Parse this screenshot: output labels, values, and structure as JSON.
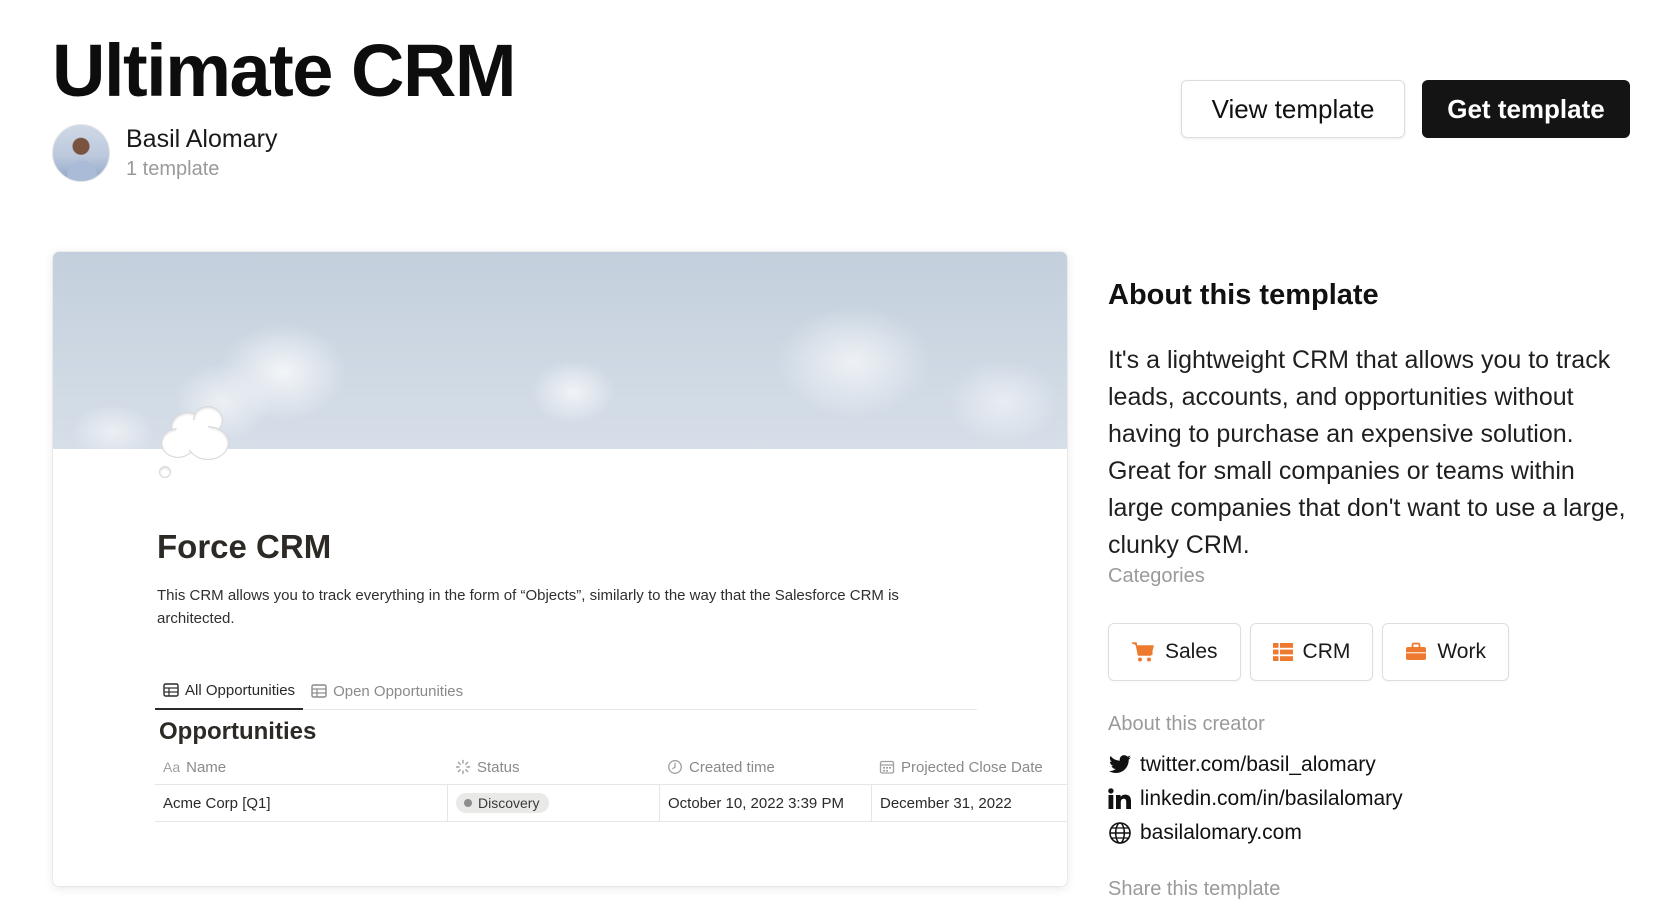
{
  "header": {
    "title": "Ultimate CRM",
    "creator_name": "Basil Alomary",
    "creator_count": "1 template",
    "view_label": "View template",
    "get_label": "Get template"
  },
  "preview": {
    "icon": "thought-cloud-icon",
    "doc_title": "Force CRM",
    "doc_description": "This CRM allows you to track everything in the form of “Objects”, similarly to the way that the Salesforce CRM is architected.",
    "tabs": [
      {
        "label": "All Opportunities",
        "icon": "table-icon",
        "active": true
      },
      {
        "label": "Open Opportunities",
        "icon": "table-icon",
        "active": false
      }
    ],
    "database_title": "Opportunities",
    "columns": [
      {
        "label": "Name",
        "prefix": "Aa",
        "icon": "text-icon"
      },
      {
        "label": "Status",
        "icon": "status-icon"
      },
      {
        "label": "Created time",
        "icon": "clock-icon"
      },
      {
        "label": "Projected Close Date",
        "icon": "calendar-icon"
      }
    ],
    "rows": [
      {
        "name": "Acme Corp [Q1]",
        "status": "Discovery",
        "created": "October 10, 2022 3:39 PM",
        "close": "December 31, 2022"
      }
    ]
  },
  "about": {
    "heading": "About this template",
    "description": "It's a lightweight CRM that allows you to track leads, accounts, and opportunities without having to purchase an expensive solution. Great for small companies or teams within large companies that don't want to use a large, clunky CRM.",
    "categories_label": "Categories",
    "categories": [
      {
        "label": "Sales",
        "icon": "shopping-cart-icon"
      },
      {
        "label": "CRM",
        "icon": "grid-icon"
      },
      {
        "label": "Work",
        "icon": "briefcase-icon"
      }
    ],
    "creator_label": "About this creator",
    "links": [
      {
        "label": "twitter.com/basil_alomary",
        "icon": "twitter-icon"
      },
      {
        "label": "linkedin.com/in/basilalomary",
        "icon": "linkedin-icon"
      },
      {
        "label": "basilalomary.com",
        "icon": "globe-icon"
      }
    ],
    "share_label": "Share this template"
  },
  "colors": {
    "accent_orange": "#ee7a2f",
    "dark_button": "#141414",
    "muted_text": "#9a9a9a"
  }
}
